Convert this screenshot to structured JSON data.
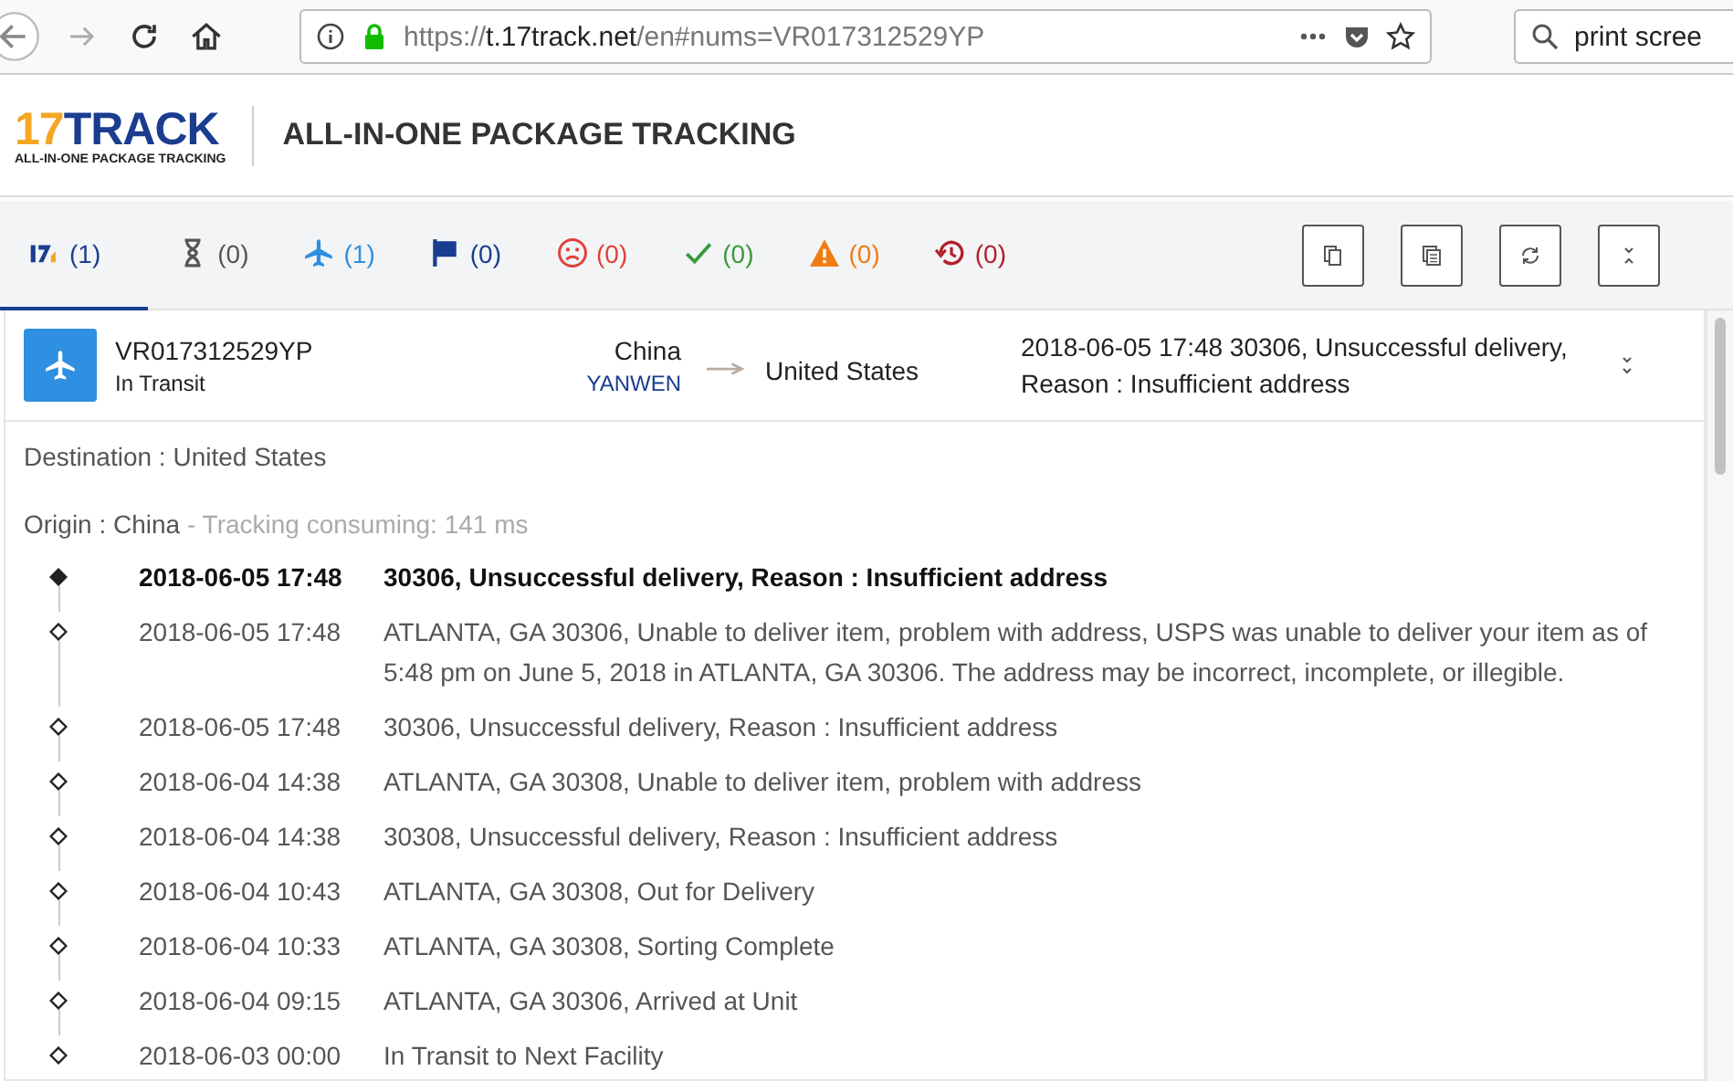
{
  "browser": {
    "url_scheme": "https://",
    "url_host": "t.17track.net",
    "url_path": "/en#nums=VR017312529YP",
    "search": "print scree"
  },
  "header": {
    "logo_main": "17TRACK",
    "logo_tagline": "ALL-IN-ONE PACKAGE TRACKING",
    "title": "ALL-IN-ONE PACKAGE TRACKING"
  },
  "filters": [
    {
      "kind": "all",
      "count": "(1)",
      "color": "#1a3d8f",
      "selected": true
    },
    {
      "kind": "hourglass",
      "count": "(0)",
      "color": "#555555",
      "selected": false
    },
    {
      "kind": "plane",
      "count": "(1)",
      "color": "#2f8fe0",
      "selected": false
    },
    {
      "kind": "flag",
      "count": "(0)",
      "color": "#1a3d8f",
      "selected": false
    },
    {
      "kind": "sad",
      "count": "(0)",
      "color": "#e0413a",
      "selected": false
    },
    {
      "kind": "check",
      "count": "(0)",
      "color": "#3a9a3a",
      "selected": false
    },
    {
      "kind": "warning",
      "count": "(0)",
      "color": "#ef7d14",
      "selected": false
    },
    {
      "kind": "history",
      "count": "(0)",
      "color": "#b3202a",
      "selected": false
    }
  ],
  "toolbar": [
    {
      "kind": "copy"
    },
    {
      "kind": "copy-list"
    },
    {
      "kind": "refresh"
    },
    {
      "kind": "collapse"
    }
  ],
  "package": {
    "number": "VR017312529YP",
    "status": "In Transit",
    "from": "China",
    "carrier": "YANWEN",
    "to": "United States",
    "latest": "2018-06-05 17:48  30306, Unsuccessful delivery, Reason : Insufficient address"
  },
  "details": {
    "destination": "Destination : United States",
    "origin": "Origin : China",
    "timing": "- Tracking consuming: 141 ms"
  },
  "events": [
    {
      "time": "2018-06-05 17:48",
      "text": "30306, Unsuccessful delivery, Reason : Insufficient address",
      "latest": true
    },
    {
      "time": "2018-06-05 17:48",
      "text": "ATLANTA, GA 30306, Unable to deliver item, problem with address, USPS was unable to deliver your item as of 5:48 pm on June 5, 2018 in ATLANTA, GA 30306. The address may be incorrect, incomplete, or illegible.",
      "latest": false
    },
    {
      "time": "2018-06-05 17:48",
      "text": "30306, Unsuccessful delivery, Reason : Insufficient address",
      "latest": false
    },
    {
      "time": "2018-06-04 14:38",
      "text": "ATLANTA, GA 30308, Unable to deliver item, problem with address",
      "latest": false
    },
    {
      "time": "2018-06-04 14:38",
      "text": "30308, Unsuccessful delivery, Reason : Insufficient address",
      "latest": false
    },
    {
      "time": "2018-06-04 10:43",
      "text": "ATLANTA, GA 30308, Out for Delivery",
      "latest": false
    },
    {
      "time": "2018-06-04 10:33",
      "text": "ATLANTA, GA 30308, Sorting Complete",
      "latest": false
    },
    {
      "time": "2018-06-04 09:15",
      "text": "ATLANTA, GA 30306, Arrived at Unit",
      "latest": false
    },
    {
      "time": "2018-06-03 00:00",
      "text": "In Transit to Next Facility",
      "latest": false
    }
  ]
}
